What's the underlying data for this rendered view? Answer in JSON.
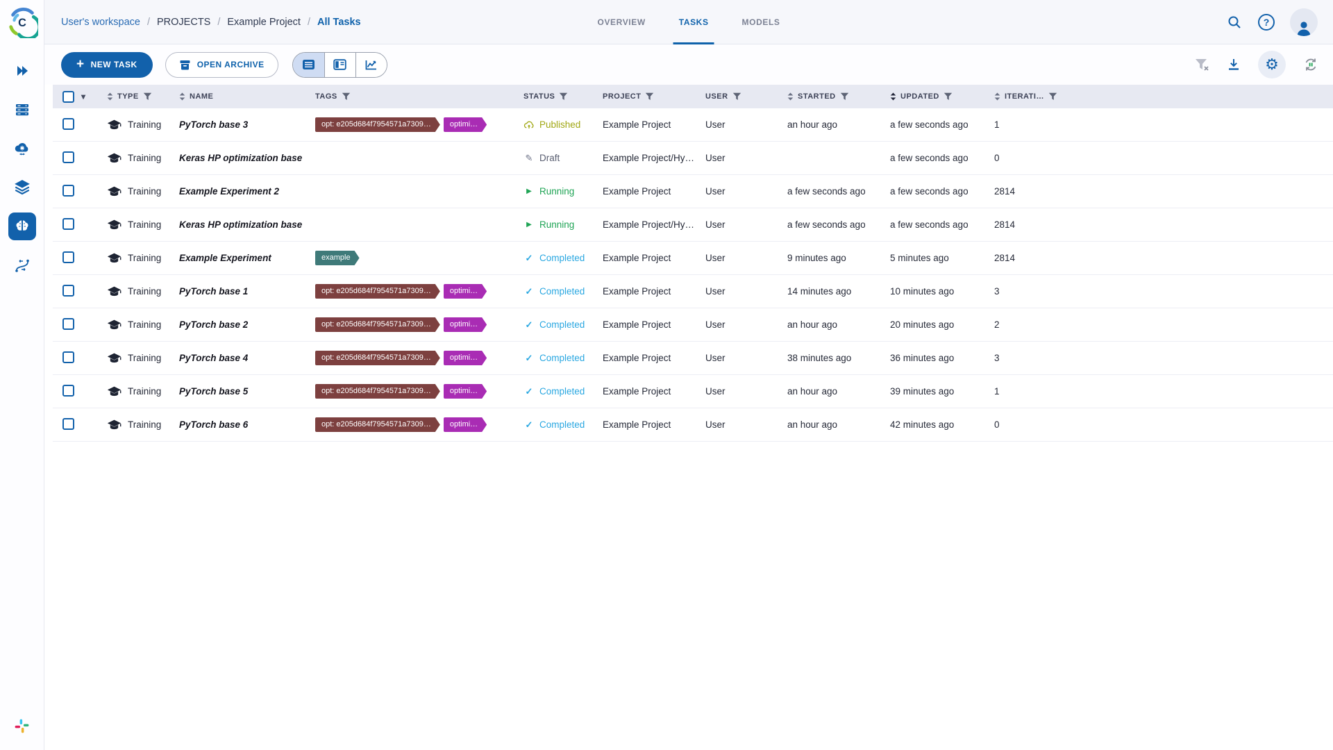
{
  "brand": {
    "name": "ClearML",
    "logo_letter": "C"
  },
  "breadcrumb": {
    "items": [
      "User's workspace",
      "PROJECTS",
      "Example Project",
      "All Tasks"
    ]
  },
  "tabs": [
    {
      "label": "OVERVIEW",
      "active": false
    },
    {
      "label": "TASKS",
      "active": true
    },
    {
      "label": "MODELS",
      "active": false
    }
  ],
  "topbar": {
    "icons": [
      "search-icon",
      "help-icon",
      "user-avatar"
    ]
  },
  "toolbar": {
    "new_task_label": "NEW TASK",
    "open_archive_label": "OPEN ARCHIVE",
    "view_toggles": [
      {
        "name": "table-view",
        "active": true
      },
      {
        "name": "details-view",
        "active": false
      },
      {
        "name": "compare-view",
        "active": false
      }
    ],
    "action_icons": [
      "clear-filters-icon",
      "download-icon",
      "settings-icon",
      "auto-refresh-icon"
    ]
  },
  "sidebar": {
    "items": [
      {
        "name": "expand",
        "active": false
      },
      {
        "name": "workers-queues",
        "active": false
      },
      {
        "name": "cloud-autoscalers",
        "active": false
      },
      {
        "name": "datasets",
        "active": false
      },
      {
        "name": "projects",
        "active": true
      },
      {
        "name": "pipelines",
        "active": false
      }
    ],
    "footer_icon": "slack"
  },
  "colors": {
    "accent": "#1261ab",
    "status_published": "#a0a713",
    "status_draft": "#585d70",
    "status_running": "#1fa455",
    "status_completed": "#29a7e1",
    "header_bg": "#e7e9f2"
  },
  "table": {
    "columns": [
      {
        "key": "type",
        "label": "TYPE",
        "sort": true,
        "filter": true,
        "sorted": false
      },
      {
        "key": "name",
        "label": "NAME",
        "sort": true,
        "filter": false,
        "sorted": false
      },
      {
        "key": "tags",
        "label": "TAGS",
        "sort": false,
        "filter": true,
        "sorted": false
      },
      {
        "key": "status",
        "label": "STATUS",
        "sort": false,
        "filter": true,
        "sorted": false
      },
      {
        "key": "project",
        "label": "PROJECT",
        "sort": false,
        "filter": true,
        "sorted": false
      },
      {
        "key": "user",
        "label": "USER",
        "sort": false,
        "filter": true,
        "sorted": false
      },
      {
        "key": "started",
        "label": "STARTED",
        "sort": true,
        "filter": true,
        "sorted": false
      },
      {
        "key": "updated",
        "label": "UPDATED",
        "sort": true,
        "filter": true,
        "sorted": true
      },
      {
        "key": "iteration",
        "label": "ITERATI…",
        "sort": true,
        "filter": true,
        "sorted": false
      }
    ],
    "rows": [
      {
        "type": "Training",
        "name": "PyTorch base 3",
        "tags": [
          {
            "label": "opt: e205d684f7954571a7309…",
            "color": "#7d403f"
          },
          {
            "label": "optimi…",
            "color": "#a92cb4"
          }
        ],
        "status": "Published",
        "status_key": "published",
        "project": "Example Project",
        "user": "User",
        "started": "an hour ago",
        "updated": "a few seconds ago",
        "iteration": "1"
      },
      {
        "type": "Training",
        "name": "Keras HP optimization base",
        "tags": [],
        "status": "Draft",
        "status_key": "draft",
        "project": "Example Project/Hy…",
        "user": "User",
        "started": "",
        "updated": "a few seconds ago",
        "iteration": "0"
      },
      {
        "type": "Training",
        "name": "Example Experiment 2",
        "tags": [],
        "status": "Running",
        "status_key": "running",
        "project": "Example Project",
        "user": "User",
        "started": "a few seconds ago",
        "updated": "a few seconds ago",
        "iteration": "2814"
      },
      {
        "type": "Training",
        "name": "Keras HP optimization base",
        "tags": [],
        "status": "Running",
        "status_key": "running",
        "project": "Example Project/Hy…",
        "user": "User",
        "started": "a few seconds ago",
        "updated": "a few seconds ago",
        "iteration": "2814"
      },
      {
        "type": "Training",
        "name": "Example Experiment",
        "tags": [
          {
            "label": "example",
            "color": "#3f7a79"
          }
        ],
        "status": "Completed",
        "status_key": "completed",
        "project": "Example Project",
        "user": "User",
        "started": "9 minutes ago",
        "updated": "5 minutes ago",
        "iteration": "2814"
      },
      {
        "type": "Training",
        "name": "PyTorch base 1",
        "tags": [
          {
            "label": "opt: e205d684f7954571a7309…",
            "color": "#7d403f"
          },
          {
            "label": "optimi…",
            "color": "#a92cb4"
          }
        ],
        "status": "Completed",
        "status_key": "completed",
        "project": "Example Project",
        "user": "User",
        "started": "14 minutes ago",
        "updated": "10 minutes ago",
        "iteration": "3"
      },
      {
        "type": "Training",
        "name": "PyTorch base 2",
        "tags": [
          {
            "label": "opt: e205d684f7954571a7309…",
            "color": "#7d403f"
          },
          {
            "label": "optimi…",
            "color": "#a92cb4"
          }
        ],
        "status": "Completed",
        "status_key": "completed",
        "project": "Example Project",
        "user": "User",
        "started": "an hour ago",
        "updated": "20 minutes ago",
        "iteration": "2"
      },
      {
        "type": "Training",
        "name": "PyTorch base 4",
        "tags": [
          {
            "label": "opt: e205d684f7954571a7309…",
            "color": "#7d403f"
          },
          {
            "label": "optimi…",
            "color": "#a92cb4"
          }
        ],
        "status": "Completed",
        "status_key": "completed",
        "project": "Example Project",
        "user": "User",
        "started": "38 minutes ago",
        "updated": "36 minutes ago",
        "iteration": "3"
      },
      {
        "type": "Training",
        "name": "PyTorch base 5",
        "tags": [
          {
            "label": "opt: e205d684f7954571a7309…",
            "color": "#7d403f"
          },
          {
            "label": "optimi…",
            "color": "#a92cb4"
          }
        ],
        "status": "Completed",
        "status_key": "completed",
        "project": "Example Project",
        "user": "User",
        "started": "an hour ago",
        "updated": "39 minutes ago",
        "iteration": "1"
      },
      {
        "type": "Training",
        "name": "PyTorch base 6",
        "tags": [
          {
            "label": "opt: e205d684f7954571a7309…",
            "color": "#7d403f"
          },
          {
            "label": "optimi…",
            "color": "#a92cb4"
          }
        ],
        "status": "Completed",
        "status_key": "completed",
        "project": "Example Project",
        "user": "User",
        "started": "an hour ago",
        "updated": "42 minutes ago",
        "iteration": "0"
      }
    ]
  }
}
